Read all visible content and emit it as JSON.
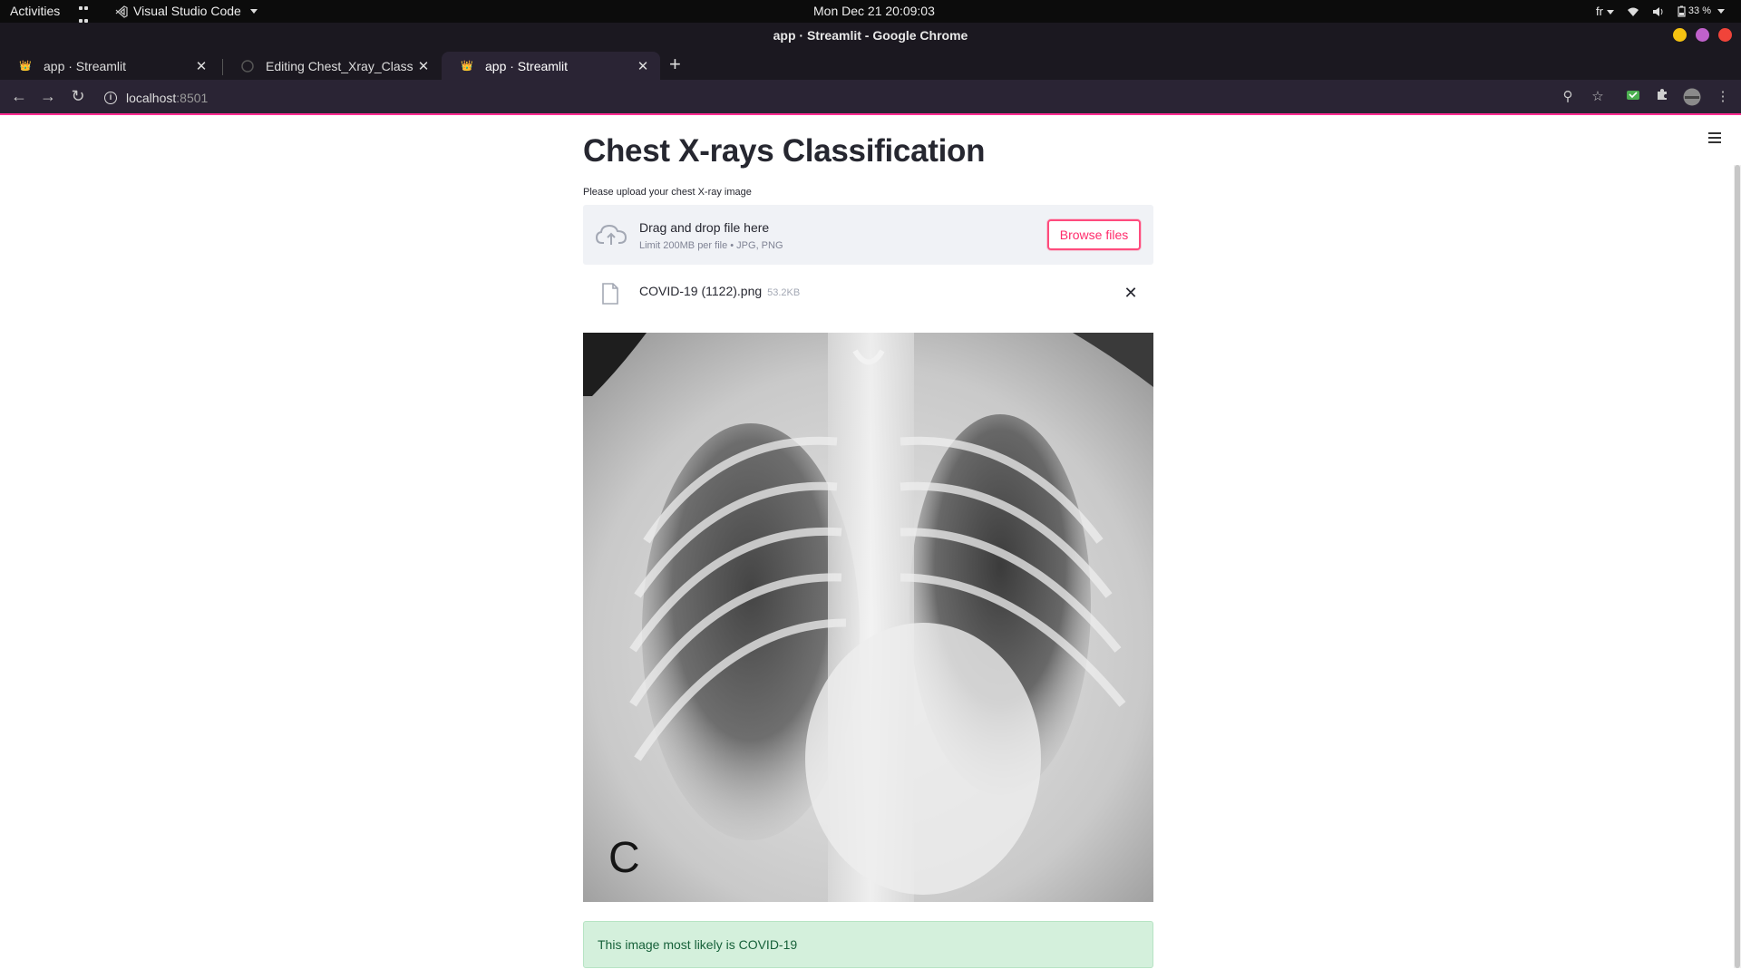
{
  "system_bar": {
    "activities": "Activities",
    "app_name": "Visual Studio Code",
    "clock": "Mon Dec 21  20:09:03",
    "keyboard_layout": "fr",
    "battery": "33 %"
  },
  "window": {
    "title": "app · Streamlit - Google Chrome",
    "controls": {
      "minimize_color": "#f5c211",
      "maximize_color": "#c061cb",
      "close_color": "#f0443a"
    }
  },
  "tabs": [
    {
      "title": "app · Streamlit",
      "icon": "streamlit-icon",
      "active": false
    },
    {
      "title": "Editing Chest_Xray_Classi",
      "icon": "github-icon",
      "active": false
    },
    {
      "title": "app · Streamlit",
      "icon": "streamlit-icon",
      "active": true
    }
  ],
  "address_bar": {
    "host": "localhost",
    "port": ":8501"
  },
  "app": {
    "title": "Chest X-rays Classification",
    "uploader": {
      "label": "Please upload your chest X-ray image",
      "drop_text": "Drag and drop file here",
      "limit_text": "Limit 200MB per file • JPG, PNG",
      "browse_label": "Browse files"
    },
    "uploaded_file": {
      "name": "COVID-19 (1122).png",
      "size": "53.2KB"
    },
    "image": {
      "corner_letter": "C"
    },
    "result": {
      "message": "This image most likely is COVID-19"
    }
  },
  "colors": {
    "accent": "#ff4b7d",
    "success_bg": "#d4f0dc",
    "success_text": "#17613a",
    "dropzone_bg": "#f0f2f6"
  }
}
